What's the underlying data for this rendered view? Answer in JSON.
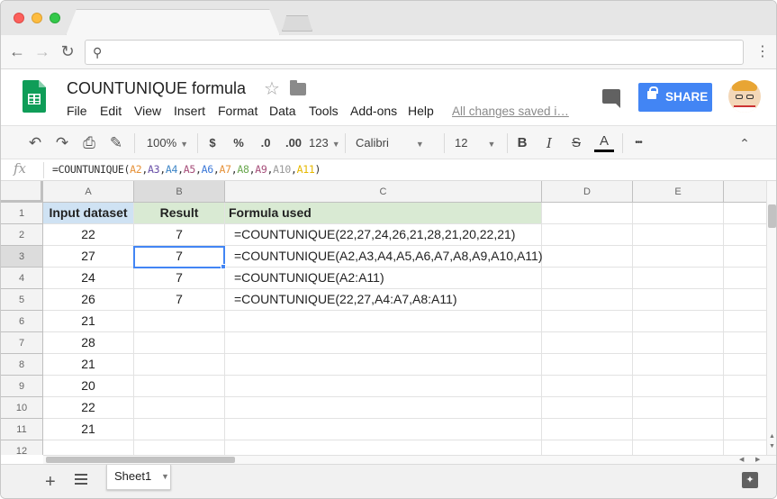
{
  "document": {
    "title": "COUNTUNIQUE formula",
    "saved_status": "All changes saved i…",
    "share_label": "SHARE"
  },
  "menus": [
    "File",
    "Edit",
    "View",
    "Insert",
    "Format",
    "Data",
    "Tools",
    "Add-ons",
    "Help"
  ],
  "toolbar": {
    "zoom": "100%",
    "currency": "$",
    "percent": "%",
    "decimal_less": ".0",
    "decimal_more": ".00",
    "more_formats": "123",
    "font": "Calibri",
    "font_size": "12",
    "bold": "B",
    "italic": "I",
    "strike": "S",
    "text_color": "A",
    "more": "•••"
  },
  "formula_bar": {
    "fx": "fx",
    "prefix": "=COUNTUNIQUE(",
    "args": [
      {
        "text": "A2",
        "color": "#e69138"
      },
      {
        "text": "A3",
        "color": "#674ea7"
      },
      {
        "text": "A4",
        "color": "#3d85c6"
      },
      {
        "text": "A5",
        "color": "#a64d79"
      },
      {
        "text": "A6",
        "color": "#3c78d8"
      },
      {
        "text": "A7",
        "color": "#e69138"
      },
      {
        "text": "A8",
        "color": "#6aa84f"
      },
      {
        "text": "A9",
        "color": "#a64d79"
      },
      {
        "text": "A10",
        "color": "#999999"
      },
      {
        "text": "A11",
        "color": "#e6b800"
      }
    ],
    "suffix": ")"
  },
  "columns": [
    "A",
    "B",
    "C",
    "D",
    "E"
  ],
  "rows": [
    "1",
    "2",
    "3",
    "4",
    "5",
    "6",
    "7",
    "8",
    "9",
    "10",
    "11",
    "12"
  ],
  "headers": {
    "a": "Input dataset",
    "b": "Result",
    "c": "Formula used"
  },
  "column_a": [
    "22",
    "27",
    "24",
    "26",
    "21",
    "28",
    "21",
    "20",
    "22",
    "21"
  ],
  "column_b": [
    "7",
    "7",
    "7",
    "7"
  ],
  "column_c": [
    "=COUNTUNIQUE(22,27,24,26,21,28,21,20,22,21)",
    "=COUNTUNIQUE(A2,A3,A4,A5,A6,A7,A8,A9,A10,A11)",
    "=COUNTUNIQUE(A2:A11)",
    "=COUNTUNIQUE(22,27,A4:A7,A8:A11)"
  ],
  "sheet_tab": "Sheet1",
  "colors": {
    "header_green": "#d9ead3",
    "header_blue": "#cfe2f3",
    "share_blue": "#4285f4",
    "selection": "#4285f4"
  }
}
